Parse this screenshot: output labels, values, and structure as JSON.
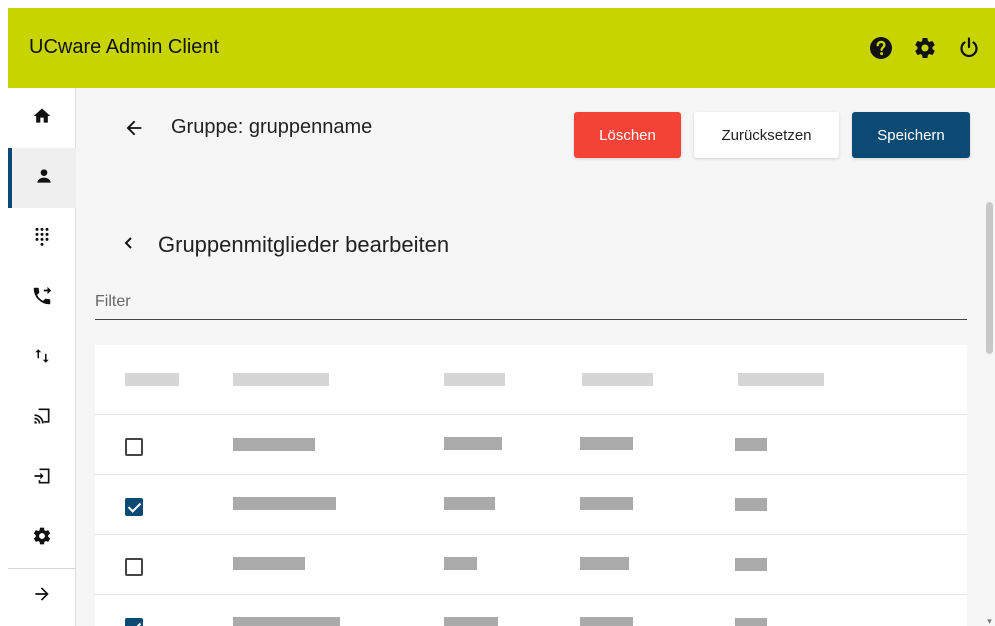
{
  "app": {
    "title": "UCware Admin Client",
    "accent": "#c8d400",
    "primary": "#0b4a73",
    "danger": "#f44336"
  },
  "header_icons": [
    "help-icon",
    "settings-icon",
    "power-icon"
  ],
  "sidebar": {
    "items": [
      {
        "icon": "home-icon",
        "active": false
      },
      {
        "icon": "user-icon",
        "active": true
      },
      {
        "icon": "dialpad-icon",
        "active": false
      },
      {
        "icon": "phone-forward-icon",
        "active": false
      },
      {
        "icon": "swap-vertical-icon",
        "active": false
      },
      {
        "icon": "cast-icon",
        "active": false
      },
      {
        "icon": "login-icon",
        "active": false
      },
      {
        "icon": "settings-icon",
        "active": false
      }
    ],
    "expand_icon": "arrow-right-icon"
  },
  "page": {
    "title": "Gruppe: gruppenname",
    "buttons": {
      "delete": "Löschen",
      "reset": "Zurücksetzen",
      "save": "Speichern"
    },
    "subsection_title": "Gruppenmitglieder bearbeiten",
    "filter_placeholder": "Filter",
    "filter_value": ""
  },
  "table": {
    "rows": [
      {
        "checked": false
      },
      {
        "checked": true
      },
      {
        "checked": false
      },
      {
        "checked": true
      }
    ]
  }
}
